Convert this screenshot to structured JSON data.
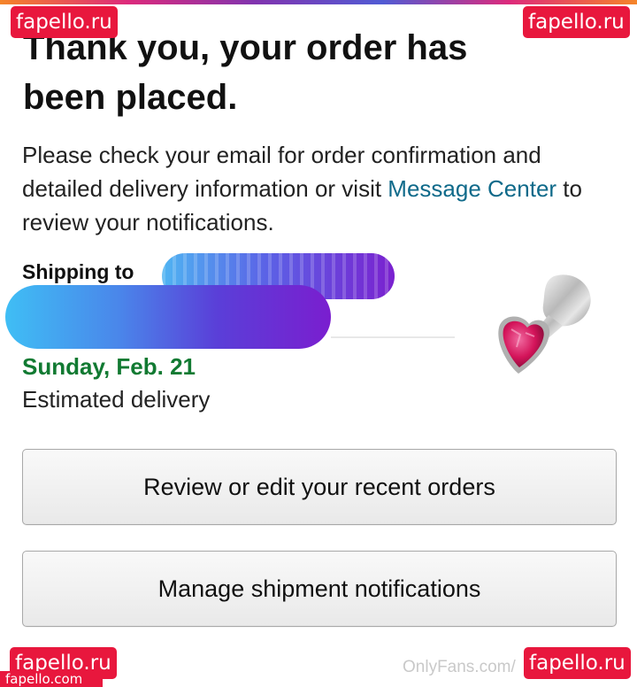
{
  "headline": {
    "line1": "Thank you, your order has",
    "line2": "been placed."
  },
  "intro": {
    "text_before_link": "Please check your email for order confirmation and detailed delivery information or visit ",
    "link_label": "Message Center",
    "text_after_link": " to review your notifications."
  },
  "shipping": {
    "label": "Shipping to"
  },
  "delivery": {
    "date": "Sunday, Feb. 21",
    "note": "Estimated delivery"
  },
  "buttons": {
    "review_orders": "Review or edit your recent orders",
    "manage_notifications": "Manage shipment notifications"
  },
  "watermarks": {
    "site": "fapello.ru",
    "site_partial": "fapello.com",
    "platform": "OnlyFans.com/"
  },
  "colors": {
    "link": "#0f6a8a",
    "delivery_date": "#117a32",
    "watermark_bg": "#e8173d",
    "product_jewel": "#d4145a"
  },
  "product": {
    "icon": "heart-jewel-product-icon"
  }
}
